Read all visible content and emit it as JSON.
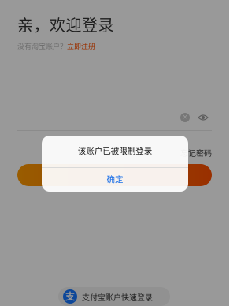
{
  "login": {
    "title": "亲，欢迎登录",
    "no_account_text": "没有淘宝账户？",
    "register_link": "立即注册",
    "forgot_password": "忘记密码",
    "quick_login_label": "支付宝账户快速登录",
    "alipay_icon": "支"
  },
  "dialog": {
    "message": "该账户已被限制登录",
    "confirm_label": "确定"
  },
  "colors": {
    "accent": "#ff5000",
    "gradient_start": "#ff9a00",
    "dialog_link": "#1a6fe8",
    "alipay_blue": "#1677ff"
  }
}
